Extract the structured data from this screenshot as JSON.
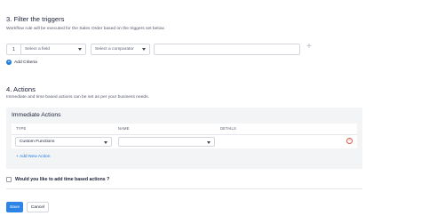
{
  "filter_section": {
    "title": "3. Filter the triggers",
    "description": "Workflow rule will be executed for the Sales Order based on the triggers set below.",
    "criteria_row": {
      "number": "1",
      "field_placeholder": "Select a field",
      "comparator_placeholder": "Select a comparator",
      "value": ""
    },
    "add_criteria_label": "Add Criteria"
  },
  "actions_section": {
    "title": "4. Actions",
    "description": "Immediate and time based actions can be set as per your business needs.",
    "immediate": {
      "title": "Immediate Actions",
      "columns": [
        "TYPE",
        "NAME",
        "DETAILS"
      ],
      "row": {
        "type_value": "Custom Functions",
        "name_value": "",
        "details_value": ""
      },
      "add_new_action_label": "+ Add New Action"
    }
  },
  "time_based": {
    "label": "Would you like to add time based actions ?",
    "checked": false
  },
  "footer": {
    "save_label": "Save",
    "cancel_label": "Cancel"
  },
  "colors": {
    "accent": "#2e84e6",
    "danger": "#e0584a",
    "panel_bg": "#f3f4f6"
  }
}
